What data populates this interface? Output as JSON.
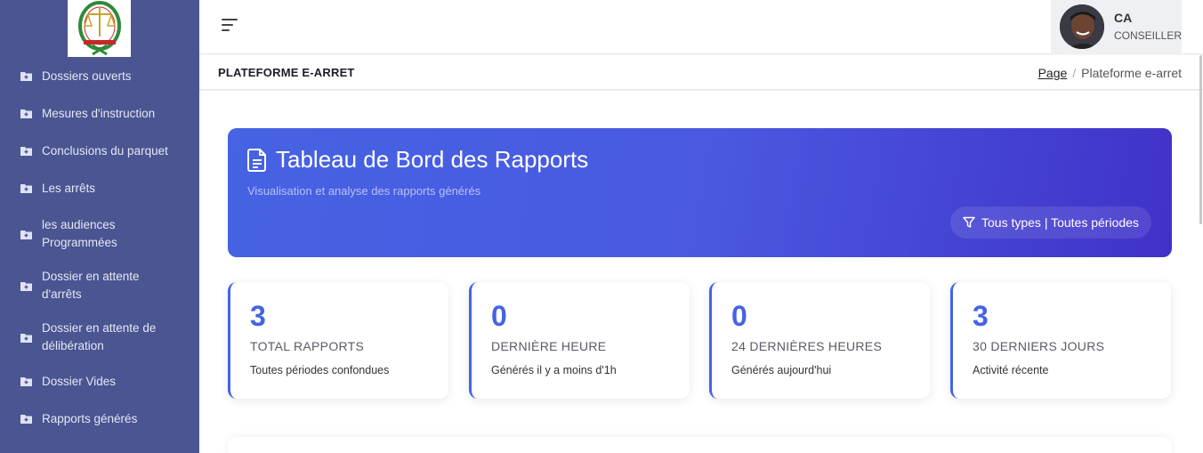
{
  "sidebar": {
    "logo_alt": "COUR SUPREME",
    "items": [
      {
        "label": "Dossiers ouverts"
      },
      {
        "label": "Mesures d'instruction"
      },
      {
        "label": "Conclusions du parquet"
      },
      {
        "label": "Les arrêts"
      },
      {
        "label": "les audiences Programmées"
      },
      {
        "label": "Dossier en attente d'arrêts"
      },
      {
        "label": "Dossier en attente de délibération"
      },
      {
        "label": "Dossier Vides"
      },
      {
        "label": "Rapports générés"
      }
    ]
  },
  "topbar": {
    "user_initials": "CA",
    "user_role": "CONSEILLER"
  },
  "subbar": {
    "title": "PLATEFORME E-ARRET",
    "breadcrumb_link": "Page",
    "breadcrumb_sep": "/",
    "breadcrumb_current": "Plateforme e-arret"
  },
  "banner": {
    "title": "Tableau de Bord des Rapports",
    "subtitle": "Visualisation et analyse des rapports générés",
    "filter_label": "Tous types | Toutes périodes"
  },
  "stats": [
    {
      "value": "3",
      "title": "TOTAL RAPPORTS",
      "desc": "Toutes périodes confondues"
    },
    {
      "value": "0",
      "title": "DERNIÈRE HEURE",
      "desc": "Générés il y a moins d'1h"
    },
    {
      "value": "0",
      "title": "24 DERNIÈRES HEURES",
      "desc": "Générés aujourd'hui"
    },
    {
      "value": "3",
      "title": "30 DERNIERS JOURS",
      "desc": "Activité récente"
    }
  ],
  "colors": {
    "sidebar_bg": "#4a5591",
    "accent": "#4563e3",
    "banner_end": "#4032c9"
  }
}
